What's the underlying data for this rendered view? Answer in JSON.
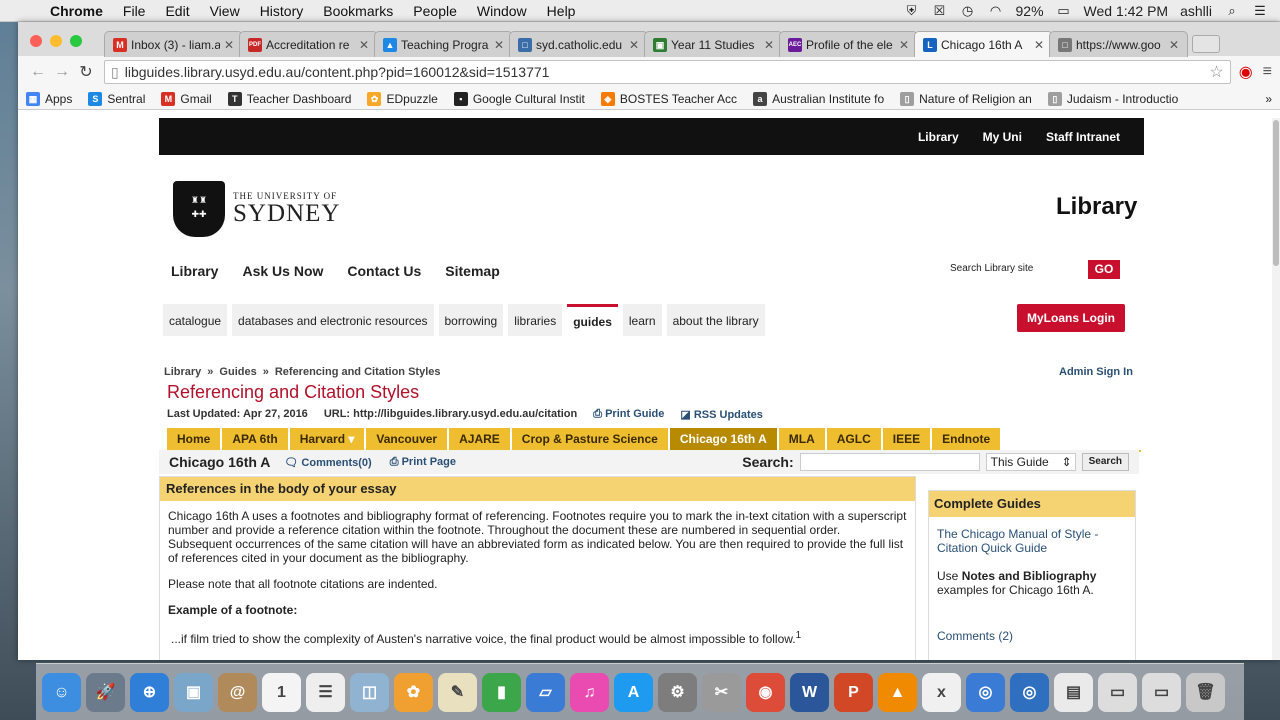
{
  "menubar": {
    "app_name": "Chrome",
    "items": [
      "File",
      "Edit",
      "View",
      "History",
      "Bookmarks",
      "People",
      "Window",
      "Help"
    ],
    "battery": "92%",
    "clock": "Wed 1:42 PM",
    "user": "ashlli"
  },
  "tabs": [
    {
      "label": "Inbox (3) - liam.a",
      "icon": "gmail-icon",
      "color": "#d93025",
      "glyph": "M"
    },
    {
      "label": "Accreditation re",
      "icon": "pdf-icon",
      "color": "#c62828",
      "glyph": "PDF"
    },
    {
      "label": "Teaching Progra",
      "icon": "drive-icon",
      "color": "#1e88e5",
      "glyph": "▲"
    },
    {
      "label": "syd.catholic.edu",
      "icon": "page-icon",
      "color": "#3b6ea8",
      "glyph": "□"
    },
    {
      "label": "Year 11 Studies",
      "icon": "classroom-icon",
      "color": "#2e7d32",
      "glyph": "▣"
    },
    {
      "label": "Profile of the ele",
      "icon": "aec-icon",
      "color": "#6a1b9a",
      "glyph": "AEC"
    },
    {
      "label": "Chicago 16th A",
      "icon": "libguides-icon",
      "color": "#1565c0",
      "glyph": "L",
      "active": true
    },
    {
      "label": "https://www.goo",
      "icon": "page-icon",
      "color": "#777777",
      "glyph": "□"
    }
  ],
  "address_bar": {
    "url": "libguides.library.usyd.edu.au/content.php?pid=160012&sid=1513771"
  },
  "bookmarks": [
    {
      "label": "Apps",
      "color": "#4285f4",
      "glyph": "▦"
    },
    {
      "label": "Sentral",
      "color": "#1e88e5",
      "glyph": "S"
    },
    {
      "label": "Gmail",
      "color": "#d93025",
      "glyph": "M"
    },
    {
      "label": "Teacher Dashboard",
      "color": "#333333",
      "glyph": "T"
    },
    {
      "label": "EDpuzzle",
      "color": "#f9a825",
      "glyph": "✿"
    },
    {
      "label": "Google Cultural Instit",
      "color": "#222222",
      "glyph": "▪"
    },
    {
      "label": "BOSTES Teacher Acc",
      "color": "#f57c00",
      "glyph": "◆"
    },
    {
      "label": "Australian Institute fo",
      "color": "#444444",
      "glyph": "a"
    },
    {
      "label": "Nature of Religion an",
      "color": "#9e9e9e",
      "glyph": "▯"
    },
    {
      "label": "Judaism - Introductio",
      "color": "#9e9e9e",
      "glyph": "▯"
    }
  ],
  "site": {
    "topbar_links": [
      "Library",
      "My Uni",
      "Staff Intranet"
    ],
    "logo_small": "THE UNIVERSITY OF",
    "logo_big": "SYDNEY",
    "library_title": "Library",
    "main_nav": [
      "Library",
      "Ask Us Now",
      "Contact Us",
      "Sitemap"
    ],
    "search_placeholder": "Search Library site",
    "go_label": "GO",
    "sub_nav": [
      "catalogue",
      "databases and electronic resources",
      "borrowing",
      "libraries",
      "guides",
      "learn",
      "about the library"
    ],
    "sub_nav_active": "guides",
    "myloans_label": "MyLoans Login"
  },
  "guide": {
    "breadcrumb": [
      "Library",
      "Guides",
      "Referencing and Citation Styles"
    ],
    "admin_sign_in": "Admin Sign In",
    "title": "Referencing and Citation Styles",
    "last_updated": "Last Updated: Apr 27, 2016",
    "url_label": "URL: http://libguides.library.usyd.edu.au/citation",
    "print_guide": "Print Guide",
    "rss": "RSS Updates",
    "tabs": [
      "Home",
      "APA 6th",
      "Harvard",
      "Vancouver",
      "AJARE",
      "Crop & Pasture Science",
      "Chicago 16th A",
      "MLA",
      "AGLC",
      "IEEE",
      "Endnote"
    ],
    "active_tab": "Chicago 16th A",
    "page_title": "Chicago 16th A",
    "comments": "Comments(0)",
    "print_page": "Print Page",
    "search_label": "Search:",
    "search_scope": "This Guide",
    "search_button": "Search"
  },
  "content_box": {
    "heading": "References in the body of your essay",
    "para1": "Chicago 16th A uses a footnotes and bibliography format of referencing. Footnotes require you to mark the in-text citation with a superscript number and provide a reference citation within the footnote. Throughout the document these are numbered in sequential order. Subsequent occurrences of the same citation will have an abbreviated form as indicated below. You are then required to provide the full list of references cited in your document as the bibliography.",
    "para2": "Please note that all footnote citations are indented.",
    "example_heading": "Example of a footnote:",
    "example_text": "...if film tried to show the complexity of Austen's narrative voice, the final product would be almost impossible to follow.",
    "example_sup": "1"
  },
  "side_box": {
    "heading": "Complete Guides",
    "link": "The Chicago Manual of Style - Citation Quick Guide",
    "use_prefix": "Use ",
    "use_bold": "Notes and Bibliography",
    "use_suffix": " examples for Chicago 16th A.",
    "comments": "Comments (2)"
  },
  "dock": [
    {
      "name": "finder-icon",
      "color": "#3d8ee0",
      "glyph": "☺"
    },
    {
      "name": "launchpad-icon",
      "color": "#6b7b8c",
      "glyph": "🚀"
    },
    {
      "name": "safari-icon",
      "color": "#2f7fd8",
      "glyph": "⊕"
    },
    {
      "name": "preview-icon",
      "color": "#7aa6c9",
      "glyph": "▣"
    },
    {
      "name": "contacts-icon",
      "color": "#b08a5a",
      "glyph": "@"
    },
    {
      "name": "calendar-icon",
      "color": "#f4f4f4",
      "glyph": "1"
    },
    {
      "name": "reminders-icon",
      "color": "#eeeeee",
      "glyph": "☰"
    },
    {
      "name": "preview2-icon",
      "color": "#8fb3d0",
      "glyph": "◫"
    },
    {
      "name": "photos-icon",
      "color": "#f0a030",
      "glyph": "✿"
    },
    {
      "name": "textedit-icon",
      "color": "#e9e0c0",
      "glyph": "✎"
    },
    {
      "name": "numbers-icon",
      "color": "#3ca64a",
      "glyph": "▮"
    },
    {
      "name": "keynote-icon",
      "color": "#3a7bd5",
      "glyph": "▱"
    },
    {
      "name": "itunes-icon",
      "color": "#e94bb0",
      "glyph": "♫"
    },
    {
      "name": "appstore-icon",
      "color": "#1e9bf0",
      "glyph": "A"
    },
    {
      "name": "system-preferences-icon",
      "color": "#7d7d7d",
      "glyph": "⚙"
    },
    {
      "name": "tools-icon",
      "color": "#9a9a9a",
      "glyph": "✂"
    },
    {
      "name": "chrome-icon",
      "color": "#dd4b39",
      "glyph": "◉"
    },
    {
      "name": "word-icon",
      "color": "#2b579a",
      "glyph": "W"
    },
    {
      "name": "powerpoint-icon",
      "color": "#d24726",
      "glyph": "P"
    },
    {
      "name": "vlc-icon",
      "color": "#f08a00",
      "glyph": "▲"
    },
    {
      "name": "app-icon",
      "color": "#f0f0f0",
      "glyph": "x"
    },
    {
      "name": "network-icon",
      "color": "#3a7bd5",
      "glyph": "◎"
    },
    {
      "name": "globe-icon",
      "color": "#2f6fc0",
      "glyph": "◎"
    },
    {
      "name": "document-icon",
      "color": "#eaeaea",
      "glyph": "▤"
    },
    {
      "name": "screenshot-icon",
      "color": "#dddddd",
      "glyph": "▭"
    },
    {
      "name": "screenshot2-icon",
      "color": "#dddddd",
      "glyph": "▭"
    },
    {
      "name": "trash-icon",
      "color": "#c8c8c8",
      "glyph": "🗑"
    }
  ]
}
